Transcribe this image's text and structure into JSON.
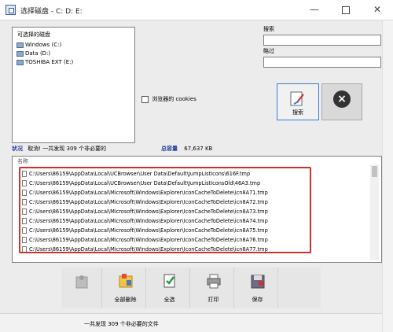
{
  "window": {
    "title": "选择磁盘 - C: D: E:",
    "minimize_symbol": "—",
    "close_symbol": "✕"
  },
  "drives": {
    "caption": "可选择的磁盘",
    "items": [
      {
        "label": "Windows (C:)"
      },
      {
        "label": "Data (D:)"
      },
      {
        "label": "TOSHIBA EXT (E:)"
      }
    ]
  },
  "options": {
    "cookies_label": "浏览器的 cookies",
    "cookies_checked": false
  },
  "search": {
    "search_label": "搜索",
    "search_value": "",
    "skip_label": "略过",
    "skip_value": ""
  },
  "buttons": {
    "search_label": "搜索",
    "exit_symbol": "×"
  },
  "status": {
    "label": "状况",
    "message": "取消! 一共发现 309 个非必要的",
    "total_label": "总容量",
    "total_value": "67,637 KB"
  },
  "results": {
    "header": "名称",
    "rows": [
      "C:\\Users\\86159\\AppData\\Local\\UCBrowser\\User Data\\Default\\JumpListIcons\\616F.tmp",
      "C:\\Users\\86159\\AppData\\Local\\UCBrowser\\User Data\\Default\\JumpListIconsOld\\46A3.tmp",
      "C:\\Users\\86159\\AppData\\Local\\Microsoft\\Windows\\Explorer\\IconCacheToDelete\\icn8A71.tmp",
      "C:\\Users\\86159\\AppData\\Local\\Microsoft\\Windows\\Explorer\\IconCacheToDelete\\icn8A72.tmp",
      "C:\\Users\\86159\\AppData\\Local\\Microsoft\\Windows\\Explorer\\IconCacheToDelete\\icn8A73.tmp",
      "C:\\Users\\86159\\AppData\\Local\\Microsoft\\Windows\\Explorer\\IconCacheToDelete\\icn8A74.tmp",
      "C:\\Users\\86159\\AppData\\Local\\Microsoft\\Windows\\Explorer\\IconCacheToDelete\\icn8A75.tmp",
      "C:\\Users\\86159\\AppData\\Local\\Microsoft\\Windows\\Explorer\\IconCacheToDelete\\icn8A76.tmp",
      "C:\\Users\\86159\\AppData\\Local\\Microsoft\\Windows\\Explorer\\IconCacheToDelete\\icn8A77.tmp"
    ]
  },
  "toolbar": {
    "items": [
      {
        "label": "",
        "disabled": true
      },
      {
        "label": "全部删除"
      },
      {
        "label": "全选"
      },
      {
        "label": "打印"
      },
      {
        "label": "保存"
      }
    ]
  },
  "statusbar": {
    "text": "一共发现 309 个非必要的文件"
  },
  "colors": {
    "accent_blue": "#1f3f99",
    "highlight_red": "#c8332b",
    "focus_blue": "#3a7bd5"
  }
}
